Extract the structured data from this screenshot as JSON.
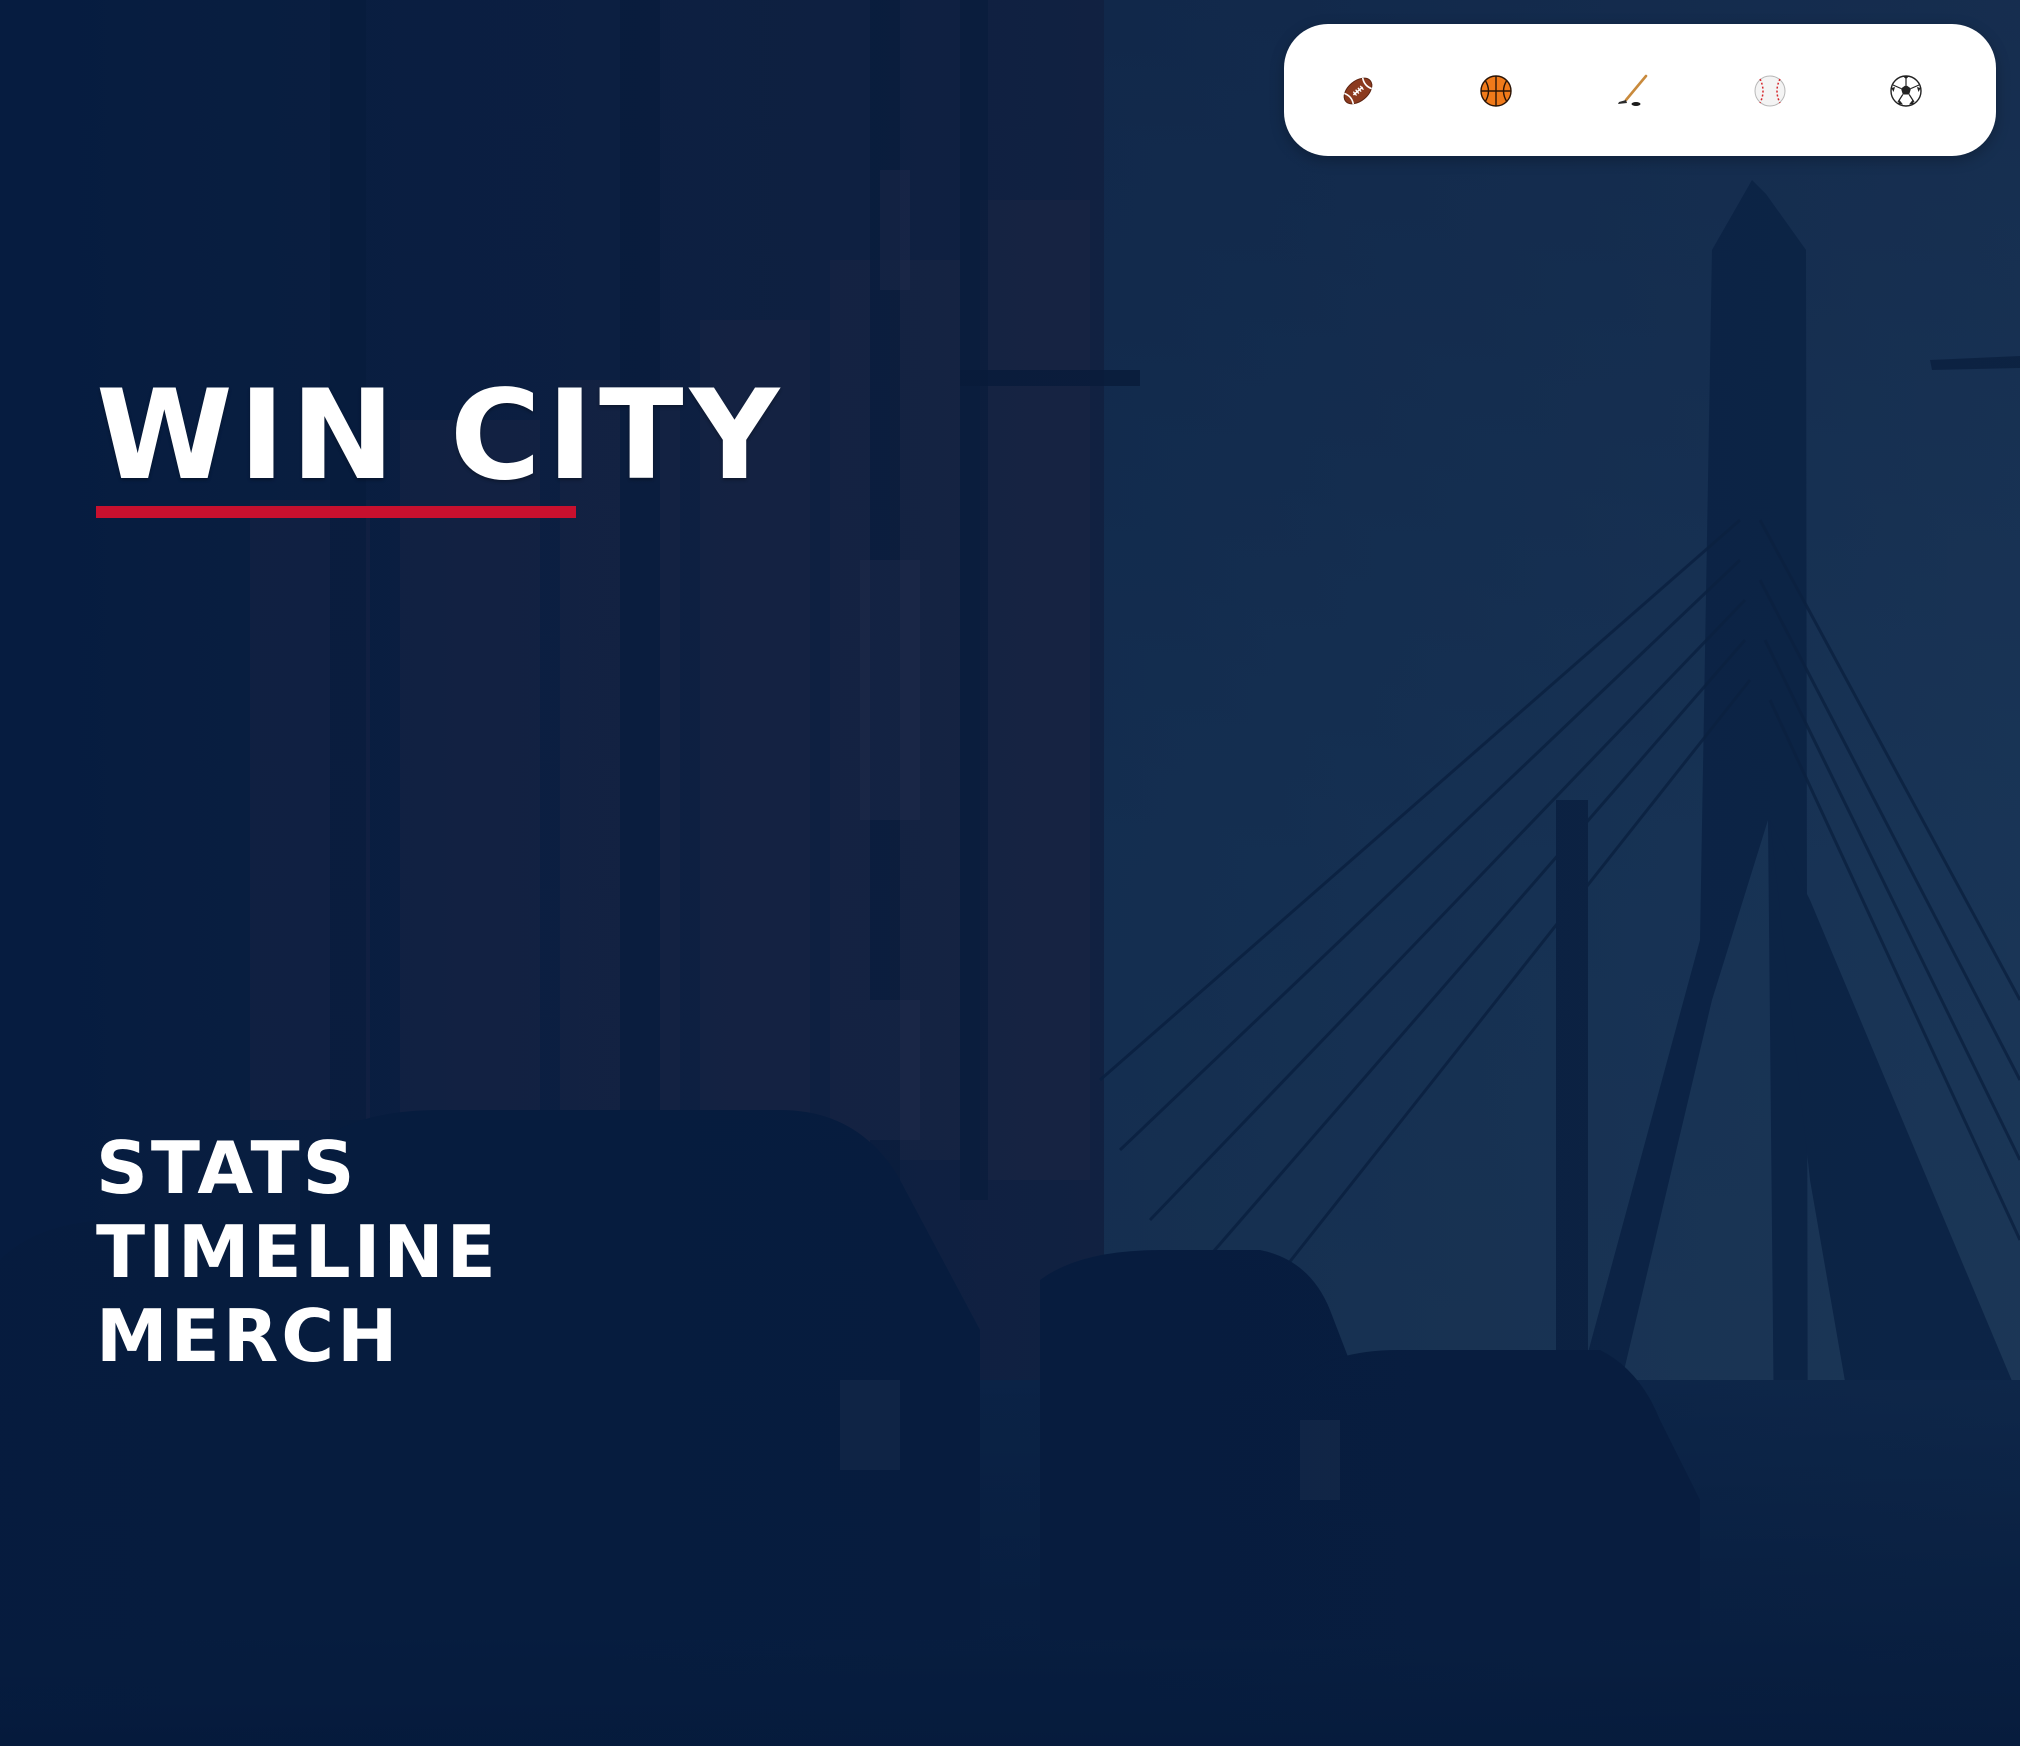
{
  "site": {
    "title": "WIN CITY",
    "accent_color": "#c8102e",
    "primary_color": "#0d2447"
  },
  "sports": [
    {
      "name": "football",
      "icon": "american-football-icon",
      "selected": false
    },
    {
      "name": "basketball",
      "icon": "basketball-icon",
      "selected": false
    },
    {
      "name": "hockey",
      "icon": "hockey-stick-icon",
      "selected": false
    },
    {
      "name": "baseball",
      "icon": "baseball-icon",
      "selected": false
    },
    {
      "name": "soccer",
      "icon": "soccer-ball-icon",
      "selected": false
    }
  ],
  "nav": {
    "items": [
      {
        "label": "STATS"
      },
      {
        "label": "TIMELINE"
      },
      {
        "label": "MERCH"
      }
    ]
  }
}
